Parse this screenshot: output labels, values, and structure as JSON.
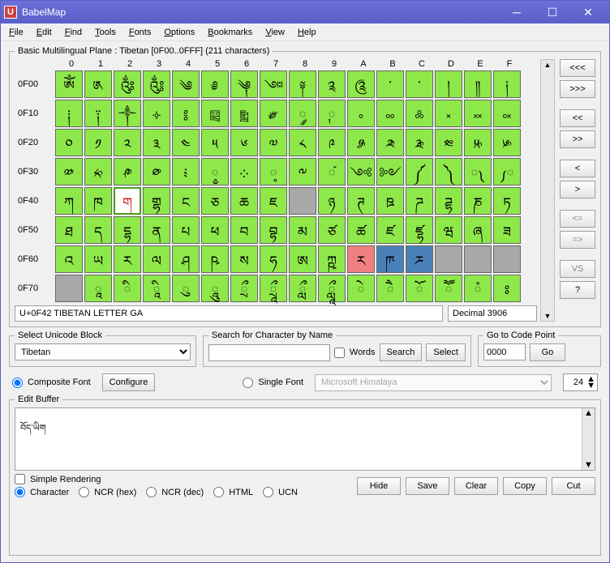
{
  "window": {
    "title": "BabelMap"
  },
  "menu": [
    "File",
    "Edit",
    "Find",
    "Tools",
    "Fonts",
    "Options",
    "Bookmarks",
    "View",
    "Help"
  ],
  "grid": {
    "legend": "Basic Multilingual Plane : Tibetan [0F00..0FFF] (211 characters)",
    "cols": [
      "0",
      "1",
      "2",
      "3",
      "4",
      "5",
      "6",
      "7",
      "8",
      "9",
      "A",
      "B",
      "C",
      "D",
      "E",
      "F"
    ],
    "rows": [
      {
        "h": "0F00",
        "c": [
          "ༀ",
          "༁",
          "༂",
          "༃",
          "༄",
          "༅",
          "༆",
          "༇",
          "༈",
          "༉",
          "༊",
          "་",
          "༌",
          "།",
          "༎",
          "༏"
        ]
      },
      {
        "h": "0F10",
        "c": [
          "༐",
          "༑",
          "༒",
          "༓",
          "༔",
          "༕",
          "༖",
          "༗",
          "༘",
          "༙",
          "༚",
          "༛",
          "༜",
          "༝",
          "༞",
          "༟"
        ]
      },
      {
        "h": "0F20",
        "c": [
          "༠",
          "༡",
          "༢",
          "༣",
          "༤",
          "༥",
          "༦",
          "༧",
          "༨",
          "༩",
          "༪",
          "༫",
          "༬",
          "༭",
          "༮",
          "༯"
        ]
      },
      {
        "h": "0F30",
        "c": [
          "༰",
          "༱",
          "༲",
          "༳",
          "༴",
          "༵",
          "༶",
          "༷",
          "༸",
          "༹",
          "༺",
          "༻",
          "༼",
          "༽",
          "༾",
          "༿"
        ]
      },
      {
        "h": "0F40",
        "c": [
          "ཀ",
          "ཁ",
          "ག",
          "གྷ",
          "ང",
          "ཅ",
          "ཆ",
          "ཇ",
          "઄",
          "ཉ",
          "ཊ",
          "ཋ",
          "ཌ",
          "ཌྷ",
          "ཎ",
          "ཏ"
        ]
      },
      {
        "h": "0F50",
        "c": [
          "ཐ",
          "ད",
          "དྷ",
          "ན",
          "པ",
          "ཕ",
          "བ",
          "བྷ",
          "མ",
          "ཙ",
          "ཚ",
          "ཛ",
          "ཛྷ",
          "ཝ",
          "ཞ",
          "ཟ"
        ]
      },
      {
        "h": "0F60",
        "c": [
          "འ",
          "ཡ",
          "ར",
          "ལ",
          "ཤ",
          "ཥ",
          "ས",
          "ཧ",
          "ཨ",
          "ཀྵ",
          "ཪ",
          "ཫ",
          "ཬ",
          "཭",
          "཮",
          "཯"
        ]
      },
      {
        "h": "0F70",
        "c": [
          "཰",
          "ཱ",
          "ི",
          "ཱི",
          "ུ",
          "ཱུ",
          "ྲྀ",
          "ཷ",
          "ླྀ",
          "ཹ",
          "ེ",
          "ཻ",
          "ོ",
          "ཽ",
          "ཾ",
          "ཿ"
        ]
      }
    ],
    "special": {
      "0F42": "sel",
      "0F48": "gray",
      "0F6A": "red",
      "0F6B": "blue",
      "0F6C": "blue",
      "0F6D": "gray",
      "0F6E": "gray",
      "0F6F": "gray",
      "0F70": "gray"
    }
  },
  "nav": {
    "first": "<<<",
    "last": ">>>",
    "prevblk": "<<",
    "nextblk": ">>",
    "prev": "<",
    "next": ">",
    "le": "<=",
    "ge": "=>",
    "vs": "VS",
    "help": "?"
  },
  "status": {
    "name": "U+0F42 TIBETAN LETTER GA",
    "dec": "Decimal 3906"
  },
  "blockSelect": {
    "legend": "Select Unicode Block",
    "value": "Tibetan"
  },
  "search": {
    "legend": "Search for Character by Name",
    "value": "",
    "words": "Words",
    "searchBtn": "Search",
    "selectBtn": "Select"
  },
  "goto": {
    "legend": "Go to Code Point",
    "value": "0000",
    "btn": "Go"
  },
  "fontRow": {
    "composite": "Composite Font",
    "configure": "Configure",
    "single": "Single Font",
    "fontName": "Microsoft Himalaya",
    "size": "24"
  },
  "edit": {
    "legend": "Edit Buffer",
    "value": "བོད་ཡིག",
    "simple": "Simple Rendering",
    "radios": [
      "Character",
      "NCR (hex)",
      "NCR (dec)",
      "HTML",
      "UCN"
    ],
    "btns": [
      "Hide",
      "Save",
      "Clear",
      "Copy",
      "Cut"
    ]
  }
}
